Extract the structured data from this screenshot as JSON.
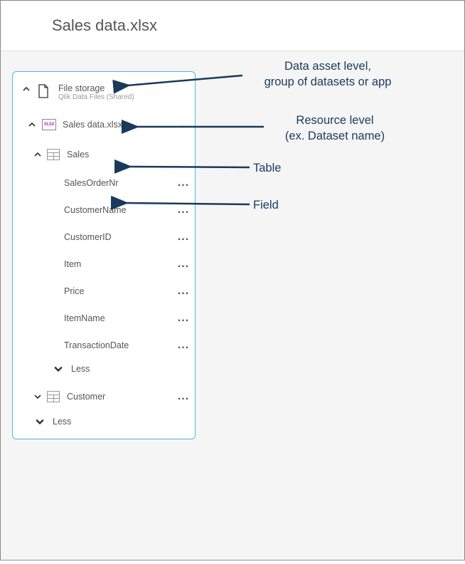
{
  "header": {
    "title": "Sales data.xlsx"
  },
  "tree": {
    "asset": {
      "label": "File storage",
      "subtitle": "Qlik Data Files (Shared)"
    },
    "resource": {
      "label": "Sales data.xlsx",
      "iconText": "XLSX"
    },
    "tables": [
      {
        "label": "Sales",
        "fields": [
          {
            "label": "SalesOrderNr"
          },
          {
            "label": "CustomerName"
          },
          {
            "label": "CustomerID"
          },
          {
            "label": "Item"
          },
          {
            "label": "Price"
          },
          {
            "label": "ItemName"
          },
          {
            "label": "TransactionDate"
          }
        ],
        "lessLabel": "Less"
      },
      {
        "label": "Customer"
      }
    ],
    "lessLabel": "Less"
  },
  "annotations": {
    "asset": "Data asset level,\ngroup of datasets or app",
    "resource": "Resource level\n(ex. Dataset name)",
    "table": "Table",
    "field": "Field"
  }
}
